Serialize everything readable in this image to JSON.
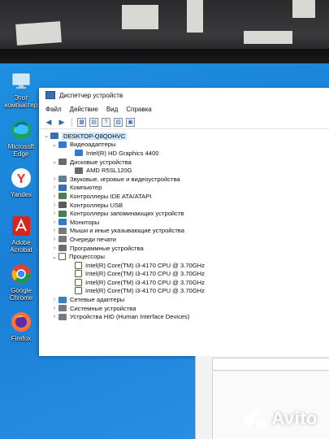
{
  "desktop": {
    "icons": [
      {
        "name": "this-pc-icon",
        "label": "Этот компьютер"
      },
      {
        "name": "microsoft-edge-icon",
        "label": "Microsoft Edge"
      },
      {
        "name": "yandex-icon",
        "label": "Yandex"
      },
      {
        "name": "adobe-acrobat-icon",
        "label": "Adobe Acrobat"
      },
      {
        "name": "google-chrome-icon",
        "label": "Google Chrome"
      },
      {
        "name": "firefox-icon",
        "label": "Firefox"
      }
    ]
  },
  "window": {
    "title": "Диспетчер устройств",
    "menu": [
      "Файл",
      "Действие",
      "Вид",
      "Справка"
    ],
    "tree": [
      {
        "level": 0,
        "expander": "v",
        "icon": "computer-icon",
        "color": "#3a6fb3",
        "label": "DESKTOP-Q8QDHVC",
        "selected": true
      },
      {
        "level": 1,
        "expander": "v",
        "icon": "display-adapter-icon",
        "color": "#2e7ccf",
        "label": "Видеоадаптеры"
      },
      {
        "level": 2,
        "expander": "",
        "icon": "display-adapter-icon",
        "color": "#2e7ccf",
        "label": "Intel(R) HD Graphics 4400"
      },
      {
        "level": 1,
        "expander": "v",
        "icon": "disk-drive-icon",
        "color": "#6b6b6b",
        "label": "Дисковые устройства"
      },
      {
        "level": 2,
        "expander": "",
        "icon": "disk-drive-icon",
        "color": "#6b6b6b",
        "label": "AMD R5SL120G"
      },
      {
        "level": 1,
        "expander": ">",
        "icon": "sound-icon",
        "color": "#5f7d95",
        "label": "Звуковые, игровые и видеоустройства"
      },
      {
        "level": 1,
        "expander": ">",
        "icon": "computer-icon",
        "color": "#3a6fb3",
        "label": "Компьютер"
      },
      {
        "level": 1,
        "expander": ">",
        "icon": "ide-controller-icon",
        "color": "#4a7f56",
        "label": "Контроллеры IDE ATA/ATAPI"
      },
      {
        "level": 1,
        "expander": ">",
        "icon": "usb-controller-icon",
        "color": "#5b5b5b",
        "label": "Контроллеры USB"
      },
      {
        "level": 1,
        "expander": ">",
        "icon": "storage-controller-icon",
        "color": "#4a7f56",
        "label": "Контроллеры запоминающих устройств"
      },
      {
        "level": 1,
        "expander": ">",
        "icon": "monitor-icon",
        "color": "#2e7ccf",
        "label": "Мониторы"
      },
      {
        "level": 1,
        "expander": ">",
        "icon": "mouse-icon",
        "color": "#7a7a7a",
        "label": "Мыши и иные указывающие устройства"
      },
      {
        "level": 1,
        "expander": ">",
        "icon": "print-queue-icon",
        "color": "#7a7a7a",
        "label": "Очереди печати"
      },
      {
        "level": 1,
        "expander": ">",
        "icon": "software-device-icon",
        "color": "#6d6d6d",
        "label": "Программные устройства"
      },
      {
        "level": 1,
        "expander": "v",
        "icon": "processor-icon",
        "color": "#4a6a3a",
        "label": "Процессоры"
      },
      {
        "level": 2,
        "expander": "",
        "icon": "processor-icon",
        "color": "#4a6a3a",
        "label": "Intel(R) Core(TM) i3-4170 CPU @ 3.70GHz"
      },
      {
        "level": 2,
        "expander": "",
        "icon": "processor-icon",
        "color": "#4a6a3a",
        "label": "Intel(R) Core(TM) i3-4170 CPU @ 3.70GHz"
      },
      {
        "level": 2,
        "expander": "",
        "icon": "processor-icon",
        "color": "#4a6a3a",
        "label": "Intel(R) Core(TM) i3-4170 CPU @ 3.70GHz"
      },
      {
        "level": 2,
        "expander": "",
        "icon": "processor-icon",
        "color": "#4a6a3a",
        "label": "Intel(R) Core(TM) i3-4170 CPU @ 3.70GHz"
      },
      {
        "level": 1,
        "expander": ">",
        "icon": "network-adapter-icon",
        "color": "#3a7fbf",
        "label": "Сетевые адаптеры"
      },
      {
        "level": 1,
        "expander": ">",
        "icon": "system-device-icon",
        "color": "#6b7d8f",
        "label": "Системные устройства"
      },
      {
        "level": 1,
        "expander": ">",
        "icon": "hid-icon",
        "color": "#7a7a7a",
        "label": "Устройства HID (Human Interface Devices)"
      }
    ]
  },
  "watermark": {
    "text": "Avito"
  }
}
